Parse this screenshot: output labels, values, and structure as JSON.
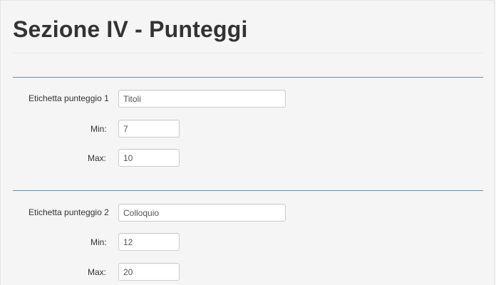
{
  "page": {
    "title": "Sezione IV - Punteggi"
  },
  "groups": [
    {
      "label_field": "Etichetta punteggio 1",
      "label_value": "Titoli",
      "min_label": "Min:",
      "min_value": "7",
      "max_label": "Max:",
      "max_value": "10"
    },
    {
      "label_field": "Etichetta punteggio 2",
      "label_value": "Colloquio",
      "min_label": "Min:",
      "min_value": "12",
      "max_label": "Max:",
      "max_value": "20"
    }
  ]
}
